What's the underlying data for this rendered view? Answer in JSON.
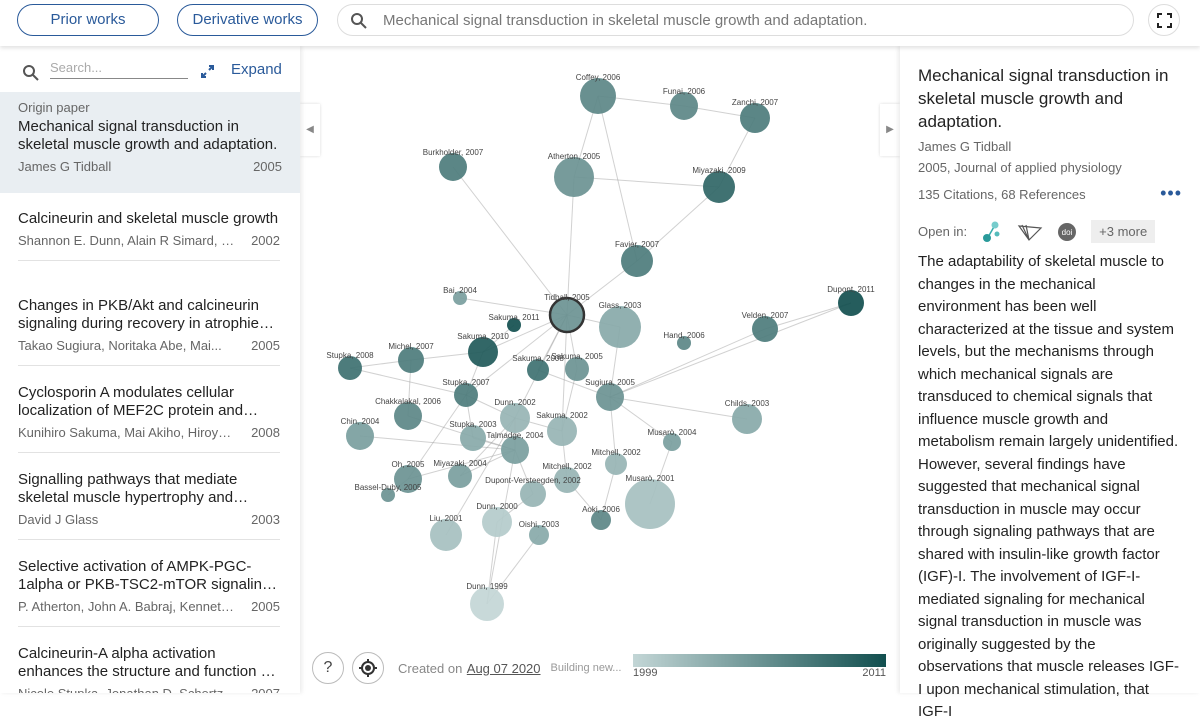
{
  "topbar": {
    "prior_works": "Prior works",
    "derivative_works": "Derivative works",
    "search_value": "Mechanical signal transduction in skeletal muscle growth and adaptation."
  },
  "left": {
    "search_placeholder": "Search...",
    "expand": "Expand",
    "origin": {
      "label": "Origin paper",
      "title": "Mechanical signal transduction in skeletal muscle growth and adaptation.",
      "authors": "James G Tidball",
      "year": "2005"
    },
    "items": [
      {
        "title": "Calcineurin and skeletal muscle growth",
        "authors": "Shannon E. Dunn, Alain R Simard, Ren...",
        "year": "2002"
      },
      {
        "title": "Changes in PKB/Akt and calcineurin signaling during recovery in atrophied skeletal muscle",
        "authors": "Takao Sugiura, Noritaka Abe, Mai...",
        "year": "2005"
      },
      {
        "title": "Cyclosporin A modulates cellular localization of MEF2C protein and blocks...",
        "authors": "Kunihiro Sakuma, Mai Akiho, Hiroyuki...",
        "year": "2008"
      },
      {
        "title": "Signalling pathways that mediate skeletal muscle hypertrophy and atrophy",
        "authors": "David J Glass",
        "year": "2003"
      },
      {
        "title": "Selective activation of AMPK-PGC-1alpha or PKB-TSC2-mTOR signaling can explain...",
        "authors": "P. Atherton, John A. Babraj, Kenneth...",
        "year": "2005"
      },
      {
        "title": "Calcineurin-A alpha activation enhances the structure and function of regenerating muscles",
        "authors": "Nicole Stupka, Jonathan D. Schertzer,...",
        "year": "2007"
      }
    ]
  },
  "graph": {
    "nodes": [
      "Coffey, 2006",
      "Funai, 2006",
      "Zanchi, 2007",
      "Burkholder, 2007",
      "Atherton, 2005",
      "Miyazaki, 2009",
      "Favier, 2007",
      "Bai, 2004",
      "Tidball, 2005",
      "Sakuma, 2011",
      "Glass, 2003",
      "Hand, 2006",
      "Velden, 2007",
      "Dupont, 2011",
      "Stupka, 2008",
      "Michel, 2007",
      "Sakuma, 2010",
      "Sakuma, 2008",
      "Sakuma, 2005",
      "Stupka, 2007",
      "Sugiura, 2005",
      "Chakkalakal, 2006",
      "Dunn, 2002",
      "Childs, 2003",
      "Chin, 2004",
      "Stupka, 2003",
      "Sakuma, 2002",
      "Talmadge, 2004",
      "Musarò, 2004",
      "Mitchell, 2002",
      "Oh, 2005",
      "Miyazaki, 2004",
      "Mitchell, 2002",
      "Bassel-Duby, 2005",
      "Dupont-Versteegden, 2002",
      "Musarò, 2001",
      "Aoki, 2006",
      "Dunn, 2000",
      "Liu, 2001",
      "Oishi, 2003",
      "Dunn, 1999"
    ],
    "color_min": "#c3d6d6",
    "color_max": "#124f4f"
  },
  "bottom": {
    "help": "?",
    "created_prefix": "Created on",
    "created_date": "Aug 07 2020",
    "building": "Building new...",
    "year_min": "1999",
    "year_max": "2011"
  },
  "right": {
    "title": "Mechanical signal transduction in skeletal muscle growth and adaptation.",
    "authors": "James G Tidball",
    "pub": "2005, Journal of applied physiology",
    "counts": "135 Citations, 68 References",
    "open_in": "Open in:",
    "more": "+3 more",
    "abstract": "The adaptability of skeletal muscle to changes in the mechanical environment has been well characterized at the tissue and system levels, but the mechanisms through which mechanical signals are transduced to chemical signals that influence muscle growth and metabolism remain largely unidentified. However, several findings have suggested that mechanical signal transduction in muscle may occur through signaling pathways that are shared with insulin-like growth factor (IGF)-I. The involvement of IGF-I-mediated signaling for mechanical signal transduction in muscle was originally suggested by the observations that muscle releases IGF-I upon mechanical stimulation, that IGF-I"
  }
}
